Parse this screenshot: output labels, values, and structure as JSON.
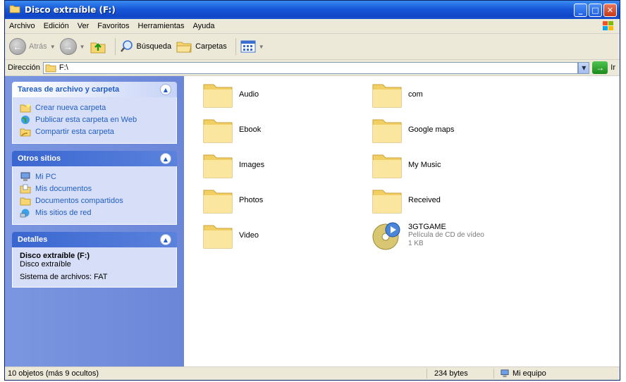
{
  "window": {
    "title": "Disco extraíble (F:)",
    "buttons": {
      "minimize": "_",
      "maximize": "□",
      "close": "✕"
    }
  },
  "menu": [
    "Archivo",
    "Edición",
    "Ver",
    "Favoritos",
    "Herramientas",
    "Ayuda"
  ],
  "toolbar": {
    "back": "Atrás",
    "search": "Búsqueda",
    "folders": "Carpetas"
  },
  "address": {
    "label": "Dirección",
    "value": "F:\\",
    "go": "Ir"
  },
  "panels": {
    "tasks": {
      "title": "Tareas de archivo y carpeta",
      "items": [
        {
          "label": "Crear nueva carpeta",
          "icon": "new-folder-icon"
        },
        {
          "label": "Publicar esta carpeta en Web",
          "icon": "globe-icon"
        },
        {
          "label": "Compartir esta carpeta",
          "icon": "share-folder-icon"
        }
      ]
    },
    "places": {
      "title": "Otros sitios",
      "items": [
        {
          "label": "Mi PC",
          "icon": "computer-icon"
        },
        {
          "label": "Mis documentos",
          "icon": "documents-icon"
        },
        {
          "label": "Documentos compartidos",
          "icon": "shared-folder-icon"
        },
        {
          "label": "Mis sitios de red",
          "icon": "network-icon"
        }
      ]
    },
    "details": {
      "title": "Detalles",
      "name": "Disco extraíble (F:)",
      "type": "Disco extraíble",
      "filesystem": "Sistema de archivos: FAT"
    }
  },
  "files": [
    {
      "name": "Audio"
    },
    {
      "name": "com"
    },
    {
      "name": "Ebook"
    },
    {
      "name": "Google maps"
    },
    {
      "name": "Images"
    },
    {
      "name": "My Music"
    },
    {
      "name": "Photos"
    },
    {
      "name": "Received"
    },
    {
      "name": "Video"
    },
    {
      "name": "3GTGAME",
      "type": "Película de CD de vídeo",
      "size": "1 KB"
    }
  ],
  "status": {
    "objects": "10 objetos (más 9 ocultos)",
    "size": "234 bytes",
    "location": "Mi equipo"
  },
  "colors": {
    "titlebar": "#1858d8",
    "left_pane": "#7b97e0",
    "task_link": "#215dc6",
    "folder": "#f5d878"
  }
}
